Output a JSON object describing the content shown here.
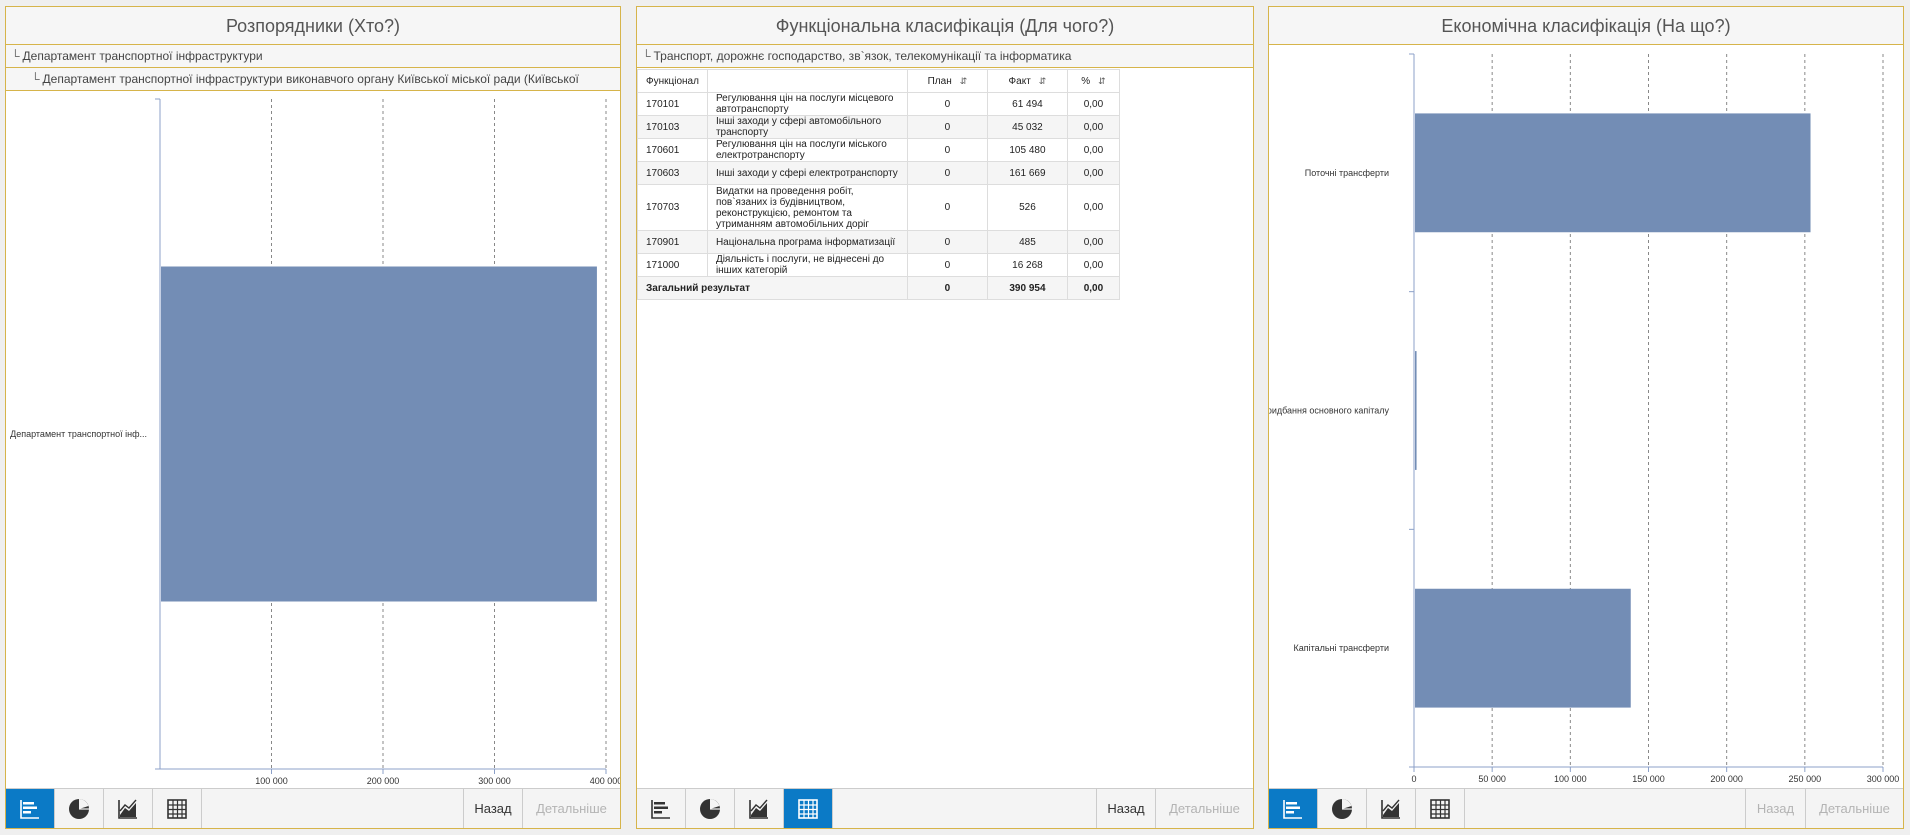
{
  "panels": {
    "who": {
      "title": "Розпорядники (Хто?)",
      "breadcrumbs": [
        "Департамент транспортної інфраструктури",
        "Департамент транспортної інфраструктури виконавчого органу Київської міської ради (Київської"
      ]
    },
    "function": {
      "title": "Функціональна класифікація (Для чого?)",
      "breadcrumbs": [
        "Транспорт, дорожнє господарство, зв`язок, телекомунікації та інформатика"
      ]
    },
    "economic": {
      "title": "Економічна класифікація (На що?)"
    }
  },
  "breadcrumb_arrow": "└",
  "toolbar": {
    "back_label": "Назад",
    "details_label": "Детальніше",
    "icons": [
      "bar-chart-icon",
      "pie-chart-icon",
      "area-chart-icon",
      "table-icon"
    ]
  },
  "table": {
    "headers": {
      "code": "Функціонал",
      "name": "",
      "plan": "План",
      "fact": "Факт",
      "percent": "%"
    },
    "sort_glyph": "⇵",
    "rows": [
      {
        "code": "170101",
        "name": "Регулювання цін на послуги місцевого автотранспорту",
        "plan": "0",
        "fact": "61 494",
        "percent": "0,00"
      },
      {
        "code": "170103",
        "name": "Інші заходи у сфері автомобільного транспорту",
        "plan": "0",
        "fact": "45 032",
        "percent": "0,00"
      },
      {
        "code": "170601",
        "name": "Регулювання цін на послуги міського електротранспорту",
        "plan": "0",
        "fact": "105 480",
        "percent": "0,00"
      },
      {
        "code": "170603",
        "name": "Інші заходи у сфері електротранспорту",
        "plan": "0",
        "fact": "161 669",
        "percent": "0,00"
      },
      {
        "code": "170703",
        "name": "Видатки на проведення робіт, пов`язаних із будівництвом, реконструкцією, ремонтом та утриманням автомобільних доріг",
        "plan": "0",
        "fact": "526",
        "percent": "0,00"
      },
      {
        "code": "170901",
        "name": "Національна програма інформатизації",
        "plan": "0",
        "fact": "485",
        "percent": "0,00"
      },
      {
        "code": "171000",
        "name": "Діяльність і послуги, не віднесені до інших категорій",
        "plan": "0",
        "fact": "16 268",
        "percent": "0,00"
      }
    ],
    "total": {
      "label": "Загальний результат",
      "plan": "0",
      "fact": "390 954",
      "percent": "0,00"
    }
  },
  "chart_data": [
    {
      "type": "bar",
      "orientation": "horizontal",
      "categories": [
        "Департамент транспортної інф..."
      ],
      "values": [
        390954
      ],
      "xlim": [
        0,
        400000
      ],
      "xticks": [
        "100 000",
        "200 000",
        "300 000",
        "400 000"
      ],
      "xtick_values": [
        100000,
        200000,
        300000,
        400000
      ],
      "grid": true,
      "bar_color": "#738dB5"
    },
    {
      "type": "bar",
      "orientation": "horizontal",
      "categories": [
        "Поточні трансферти",
        "Придбання основного капіталу",
        "Капітальні трансферти"
      ],
      "values": [
        253000,
        1000,
        138000
      ],
      "xlim": [
        0,
        300000
      ],
      "xticks": [
        "0",
        "50 000",
        "100 000",
        "150 000",
        "200 000",
        "250 000",
        "300 000"
      ],
      "xtick_values": [
        0,
        50000,
        100000,
        150000,
        200000,
        250000,
        300000
      ],
      "grid": true,
      "bar_color": "#738dB5"
    }
  ]
}
